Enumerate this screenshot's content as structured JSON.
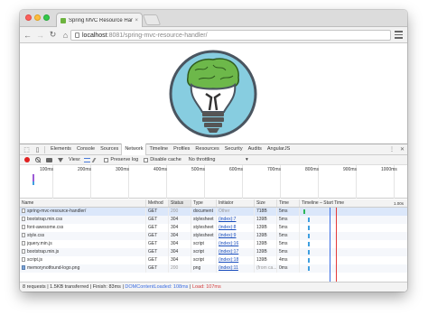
{
  "browser": {
    "tab_title": "Spring MVC Resource Han",
    "tab_close": "×",
    "url_host": "localhost",
    "url_rest": ":8081/spring-mvc-resource-handler/"
  },
  "devtools": {
    "tabs": [
      "Elements",
      "Console",
      "Sources",
      "Network",
      "Timeline",
      "Profiles",
      "Resources",
      "Security",
      "Audits",
      "AngularJS"
    ],
    "active_tab": "Network",
    "view_label": "View:",
    "preserve_log": "Preserve log",
    "disable_cache": "Disable cache",
    "throttling": "No throttling",
    "overview_ticks": [
      "100ms",
      "200ms",
      "300ms",
      "400ms",
      "500ms",
      "600ms",
      "700ms",
      "800ms",
      "900ms",
      "1000ms"
    ],
    "columns": {
      "name": "Name",
      "method": "Method",
      "status": "Status",
      "type": "Type",
      "initiator": "Initiator",
      "size": "Size",
      "time": "Time",
      "timeline": "Timeline – Start Time",
      "timeline_tick": "1.00s"
    },
    "rows": [
      {
        "name": "spring-mvc-resource-handler/",
        "method": "GET",
        "status": "200",
        "type": "document",
        "initiator": "Other",
        "size": "718B",
        "time": "5ms",
        "icon": "doc"
      },
      {
        "name": "bootstrap.min.css",
        "method": "GET",
        "status": "304",
        "type": "stylesheet",
        "initiator": "(index):7",
        "size": "139B",
        "time": "5ms",
        "icon": "doc"
      },
      {
        "name": "font-awesome.css",
        "method": "GET",
        "status": "304",
        "type": "stylesheet",
        "initiator": "(index):8",
        "size": "139B",
        "time": "5ms",
        "icon": "doc"
      },
      {
        "name": "style.css",
        "method": "GET",
        "status": "304",
        "type": "stylesheet",
        "initiator": "(index):9",
        "size": "139B",
        "time": "5ms",
        "icon": "doc"
      },
      {
        "name": "jquery.min.js",
        "method": "GET",
        "status": "304",
        "type": "script",
        "initiator": "(index):16",
        "size": "139B",
        "time": "5ms",
        "icon": "doc"
      },
      {
        "name": "bootstrap.min.js",
        "method": "GET",
        "status": "304",
        "type": "script",
        "initiator": "(index):17",
        "size": "139B",
        "time": "5ms",
        "icon": "doc"
      },
      {
        "name": "script.js",
        "method": "GET",
        "status": "304",
        "type": "script",
        "initiator": "(index):18",
        "size": "139B",
        "time": "4ms",
        "icon": "doc"
      },
      {
        "name": "memorynotfound-logo.png",
        "method": "GET",
        "status": "200",
        "type": "png",
        "initiator": "(index):11",
        "size": "(from ca...",
        "time": "0ms",
        "icon": "img"
      }
    ],
    "status": {
      "summary": "8 requests | 1.5KB transferred | Finish: 83ms | ",
      "dcl": "DOMContentLoaded: 108ms",
      "sep": " | ",
      "load": "Load: 107ms"
    }
  },
  "colors": {
    "logo_circle": "#87cde0",
    "brain": "#6db84a",
    "record": "#e02020",
    "dcl_line": "#3a6de4",
    "load_line": "#e43a3a"
  }
}
